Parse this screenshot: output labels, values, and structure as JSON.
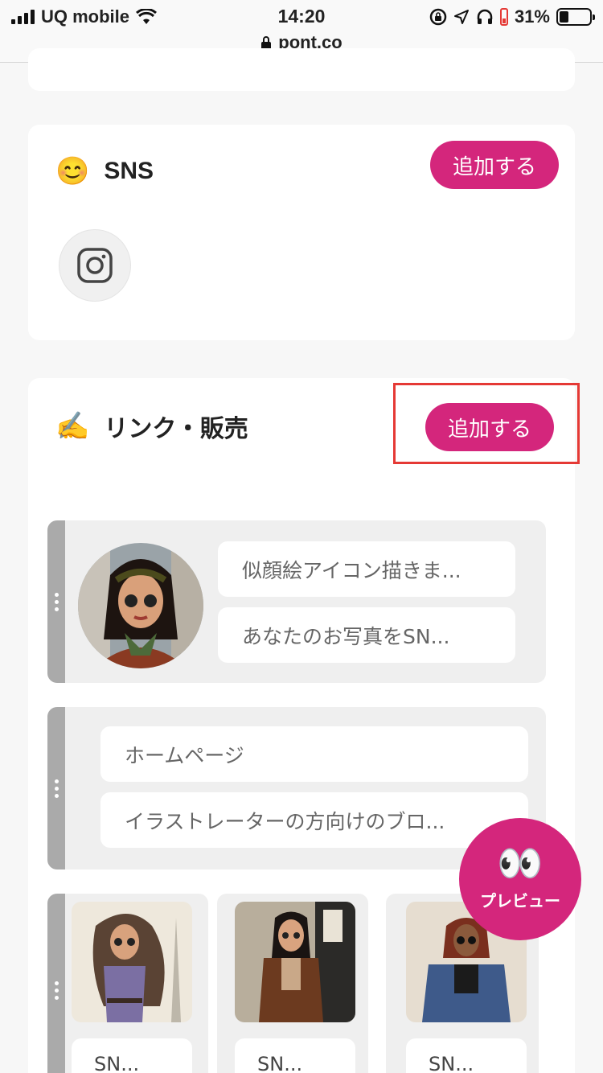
{
  "status_bar": {
    "carrier": "UQ mobile",
    "time": "14:20",
    "url": "pont.co",
    "battery": "31%",
    "battery_level": 0.31
  },
  "sns_section": {
    "emoji": "😊",
    "title": "SNS",
    "add_label": "追加する",
    "items": [
      {
        "icon": "instagram-icon"
      }
    ]
  },
  "links_section": {
    "emoji": "✍️",
    "title": "リンク・販売",
    "add_label": "追加する",
    "block1": {
      "links": [
        "似顔絵アイコン描きま...",
        "あなたのお写真をSN..."
      ]
    },
    "block2": {
      "links": [
        "ホームページ",
        "イラストレーターの方向けのブロ..."
      ]
    },
    "grid": {
      "items": [
        {
          "label": "SN..."
        },
        {
          "label": "SN..."
        },
        {
          "label": "SN..."
        }
      ]
    }
  },
  "preview_button": {
    "emoji": "👀",
    "label": "プレビュー"
  },
  "colors": {
    "accent": "#d4267c",
    "highlight": "#e53935"
  }
}
